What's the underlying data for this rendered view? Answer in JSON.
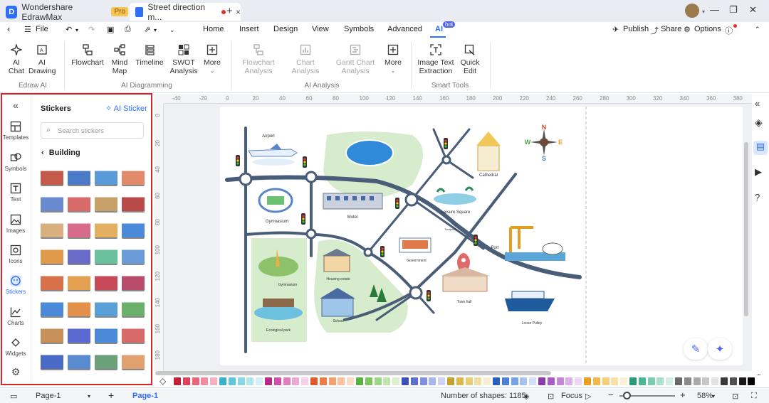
{
  "titlebar": {
    "app_name": "Wondershare EdrawMax",
    "pro_badge": "Pro",
    "doc_tab": "Street direction m...",
    "new_tab": "+",
    "close_tab": "×"
  },
  "menubar": {
    "file": "File",
    "items": [
      "Home",
      "Insert",
      "Design",
      "View",
      "Symbols",
      "Advanced",
      "AI"
    ],
    "ai_badge": "hot",
    "publish": "Publish",
    "share": "Share",
    "options": "Options"
  },
  "ribbon": {
    "edraw_ai": {
      "group": "Edraw AI",
      "ai_chat": "AI\nChat",
      "ai_drawing": "AI\nDrawing"
    },
    "diagramming": {
      "group": "AI Diagramming",
      "flowchart": "Flowchart",
      "mind_map": "Mind\nMap",
      "timeline": "Timeline",
      "swot": "SWOT\nAnalysis",
      "more": "More"
    },
    "analysis": {
      "group": "AI Analysis",
      "flowchart_analysis": "Flowchart\nAnalysis",
      "chart_analysis": "Chart\nAnalysis",
      "gantt_analysis": "Gantt Chart\nAnalysis",
      "more": "More"
    },
    "smart_tools": {
      "group": "Smart Tools",
      "image_text": "Image Text\nExtraction",
      "quick_edit": "Quick\nEdit"
    }
  },
  "rail": [
    "Templates",
    "Symbols",
    "Text",
    "Images",
    "Icons",
    "Stickers",
    "Charts",
    "Widgets"
  ],
  "library": {
    "title": "Stickers",
    "ai_sticker": "AI Sticker",
    "search_placeholder": "Search stickers",
    "category": "Building"
  },
  "ruler": {
    "h_ticks": [
      "-40",
      "-20",
      "0",
      "20",
      "40",
      "60",
      "80",
      "100",
      "120",
      "140",
      "160",
      "180",
      "200",
      "220",
      "240",
      "260",
      "280",
      "300",
      "320",
      "340",
      "360",
      "380"
    ],
    "v_ticks": [
      "0",
      "20",
      "40",
      "60",
      "80",
      "100",
      "120",
      "140",
      "160",
      "180",
      "200"
    ]
  },
  "map": {
    "labels": {
      "airport": "Airport",
      "gymnasium": "Gymnasium",
      "motel": "Motel",
      "cathedral": "Cathedral",
      "leisure_square": "Leisure Square",
      "sculpture": "Sculpture",
      "port": "Port",
      "government": "Government",
      "housing_estate": "Housing estate",
      "town_hall": "Town hall",
      "ecological_park": "Ecological park",
      "school": "School",
      "loose_pulley": "Loose Pulley"
    },
    "compass": {
      "n": "N",
      "s": "S",
      "e": "E",
      "w": "W"
    }
  },
  "statusbar": {
    "page_selector": "Page-1",
    "page_tab": "Page-1",
    "shapes": "Number of shapes: 1185",
    "focus": "Focus",
    "zoom": "58%"
  },
  "colors": {
    "accent": "#2f6ff5",
    "highlight": "#d7262b",
    "road": "#4a5d78",
    "park": "#d7eccd",
    "palette": [
      "#c4203a",
      "#e0405a",
      "#e9657e",
      "#f28ca1",
      "#f6b0c0",
      "#3bb0c8",
      "#60c6d9",
      "#8ad8e6",
      "#b0e6ef",
      "#d2f0f5",
      "#b62c8b",
      "#d14fa6",
      "#e07ec0",
      "#eea8d6",
      "#f6cfe8",
      "#e05a30",
      "#f07a45",
      "#f6a070",
      "#f9c29c",
      "#fbdcc6",
      "#5ab040",
      "#7cc560",
      "#9ed687",
      "#c0e6ae",
      "#dcf0d0",
      "#3d4fb8",
      "#5a6fd0",
      "#8090e0",
      "#a8b4ec",
      "#cdd4f5",
      "#c7a032",
      "#ddb84a",
      "#e8cd78",
      "#f0dea2",
      "#f7eecd",
      "#2860c0",
      "#4a80d8",
      "#78a2e6",
      "#a6c2f0",
      "#cfdff8",
      "#8a3ca8",
      "#a85cc4",
      "#c488d8",
      "#dab2e8",
      "#ecd6f4",
      "#e8a020",
      "#f2b84a",
      "#f6cd7a",
      "#f9e0a8",
      "#fcefd2",
      "#2a9a7a",
      "#4ab894",
      "#7ccdb0",
      "#a8e0cc",
      "#d2f0e6",
      "#6a6a6a",
      "#8a8a8a",
      "#aaaaaa",
      "#c8c8c8",
      "#e2e2e2",
      "#3a3a3a",
      "#505050",
      "#1a1a1a",
      "#000000"
    ]
  }
}
